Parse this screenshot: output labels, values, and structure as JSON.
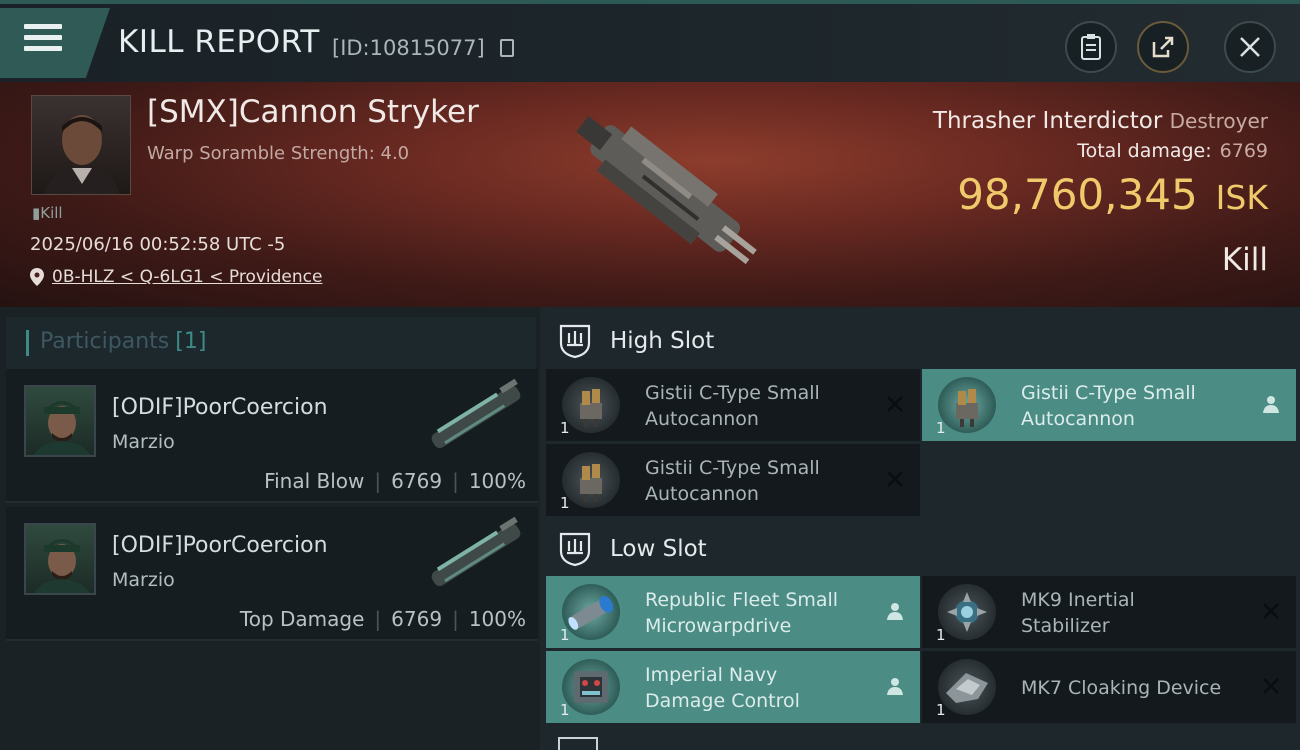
{
  "header": {
    "title": "KILL REPORT",
    "report_id": "[ID:10815077]",
    "icons": [
      "menu-icon",
      "copy-icon",
      "clipboard-icon",
      "share-icon",
      "close-icon"
    ]
  },
  "victim": {
    "name": "[SMX]Cannon Stryker",
    "scramble": "Warp Soramble Strength: 4.0",
    "tag": "Kill",
    "datetime": "2025/06/16 00:52:58 UTC -5",
    "location": "0B-HLZ < Q-6LG1 < Providence",
    "ship_name": "Thrasher Interdictor",
    "ship_class": "Destroyer",
    "total_damage_label": "Total damage:",
    "total_damage": "6769",
    "isk_value": "98,760,345",
    "isk_unit": "ISK",
    "result": "Kill"
  },
  "participants": {
    "title": "Participants",
    "count": "[1]",
    "rows": [
      {
        "name": "[ODIF]PoorCoercion",
        "corp": "Marzio",
        "role": "Final Blow",
        "damage": "6769",
        "percent": "100%"
      },
      {
        "name": "[ODIF]PoorCoercion",
        "corp": "Marzio",
        "role": "Top Damage",
        "damage": "6769",
        "percent": "100%"
      }
    ]
  },
  "fittings": {
    "high_slot_label": "High Slot",
    "low_slot_label": "Low Slot",
    "high": [
      {
        "line1": "Gistii C-Type Small",
        "line2": "Autocannon",
        "qty": "1",
        "status": "destroyed"
      },
      {
        "line1": "Gistii C-Type Small",
        "line2": "Autocannon",
        "qty": "1",
        "status": "dropped"
      },
      {
        "line1": "Gistii C-Type Small",
        "line2": "Autocannon",
        "qty": "1",
        "status": "destroyed"
      }
    ],
    "low": [
      {
        "line1": "Republic Fleet Small",
        "line2": "Microwarpdrive",
        "qty": "1",
        "status": "dropped"
      },
      {
        "line1": "MK9 Inertial",
        "line2": "Stabilizer",
        "qty": "1",
        "status": "destroyed"
      },
      {
        "line1": "Imperial Navy",
        "line2": "Damage Control",
        "qty": "1",
        "status": "dropped"
      },
      {
        "line1": "MK7 Cloaking Device",
        "line2": "",
        "qty": "1",
        "status": "destroyed"
      }
    ]
  },
  "colors": {
    "accent": "#2f5a56",
    "isk": "#efc96a",
    "dropped_bg": "#4b8c85",
    "destroyed_bg": "#13191c"
  }
}
